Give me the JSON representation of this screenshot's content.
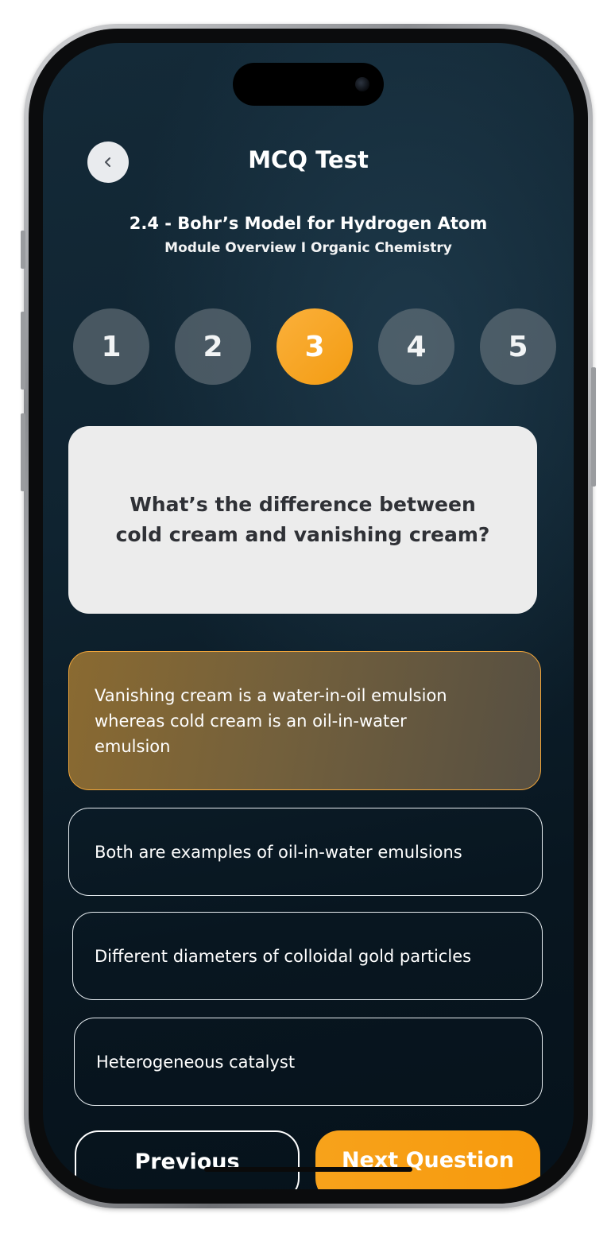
{
  "header": {
    "title": "MCQ Test",
    "back_icon": "chevron-left-icon"
  },
  "lesson": {
    "title": "2.4 - Bohr’s Model for Hydrogen Atom",
    "subtitle": "Module Overview I Organic Chemistry"
  },
  "steps": {
    "items": [
      "1",
      "2",
      "3",
      "4",
      "5"
    ],
    "active_index": 2
  },
  "question": {
    "text": "What’s the difference between cold cream and vanishing cream?"
  },
  "options": [
    "Vanishing cream is a water-in-oil emulsion whereas cold cream is an oil-in-water emulsion",
    "Both are examples of oil-in-water emulsions",
    "Different diameters of colloidal gold particles",
    "Heterogeneous catalyst"
  ],
  "selected_option_index": 0,
  "footer": {
    "previous_label": "Previous",
    "next_label": "Next Question"
  },
  "colors": {
    "accent": "#F7A21B",
    "background": "#0F2330",
    "card": "#ECECEC",
    "selected_option": "#7A6338"
  }
}
